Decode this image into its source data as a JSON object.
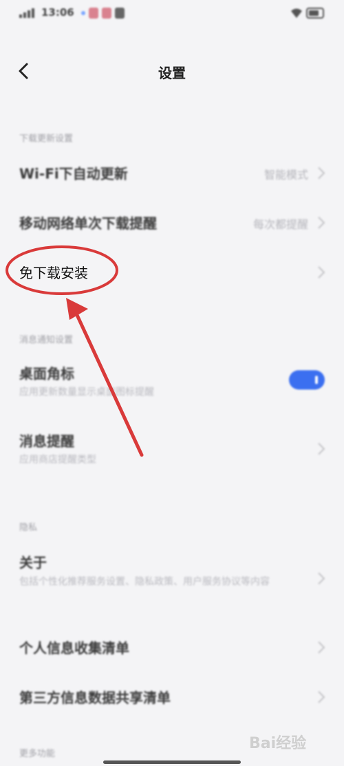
{
  "status_bar": {
    "time": "13:06"
  },
  "header": {
    "title": "设置",
    "back_icon": "chevron-left-icon"
  },
  "sections": {
    "download": {
      "title": "下载更新设置",
      "wifi_auto_update": {
        "label": "Wi-Fi下自动更新",
        "value": "智能模式"
      },
      "mobile_download_prompt": {
        "label": "移动网络单次下载提醒",
        "value": "每次都提醒"
      },
      "install_without_download": {
        "label": "免下载安装"
      }
    },
    "notifications": {
      "title": "消息通知设置",
      "badge": {
        "label": "桌面角标",
        "sub": "应用更新数量显示桌面图标提醒",
        "enabled": true
      },
      "reminder": {
        "label": "消息提醒",
        "sub": "应用商店提醒类型"
      }
    },
    "privacy": {
      "title": "隐私",
      "about": {
        "label": "关于",
        "sub": "包括个性化推荐服务设置、隐私政策、用户服务协议等内容"
      },
      "personal_info": {
        "label": "个人信息收集清单"
      },
      "third_party": {
        "label": "第三方信息数据共享清单"
      }
    },
    "bottom": {
      "title": "更多功能"
    }
  },
  "watermark": "Bai经验",
  "colors": {
    "accent": "#3b6ff0",
    "annotation": "#d93a3a"
  }
}
